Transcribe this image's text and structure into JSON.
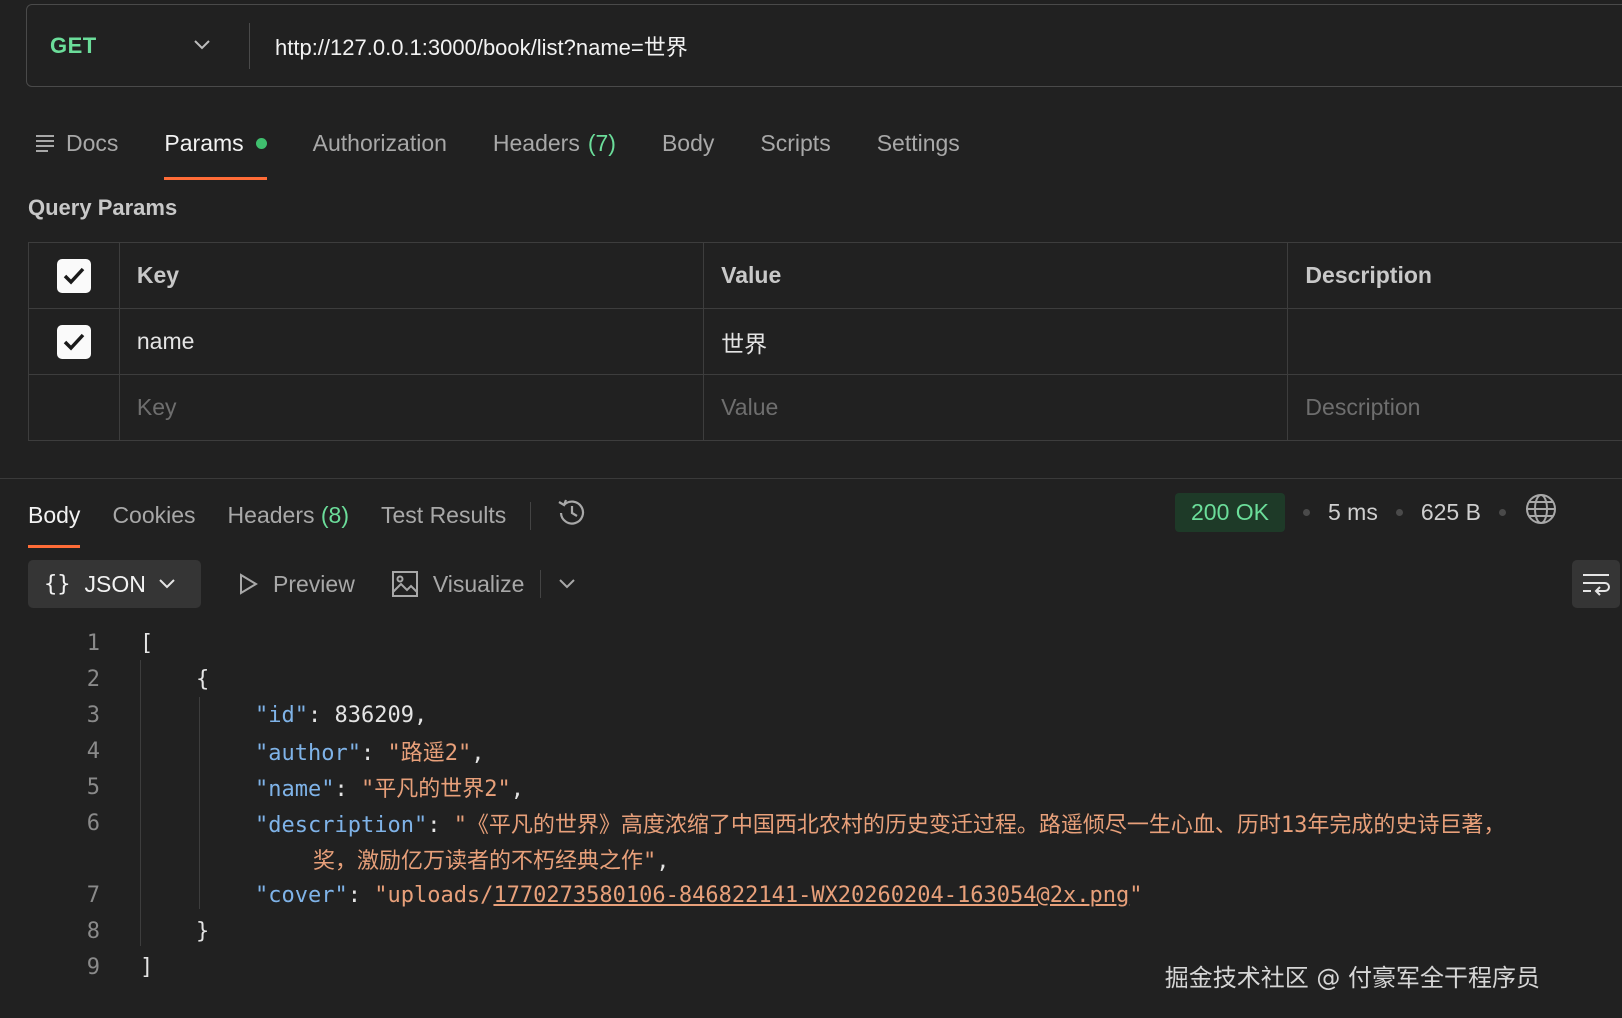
{
  "request": {
    "method": "GET",
    "url": "http://127.0.0.1:3000/book/list?name=世界"
  },
  "request_tabs": {
    "docs": "Docs",
    "params": "Params",
    "authorization": "Authorization",
    "headers": "Headers",
    "headers_count": "(7)",
    "body": "Body",
    "scripts": "Scripts",
    "settings": "Settings"
  },
  "query_params": {
    "title": "Query Params",
    "columns": {
      "key": "Key",
      "value": "Value",
      "description": "Description"
    },
    "rows": [
      {
        "checked": true,
        "key": "name",
        "value": "世界",
        "description": ""
      }
    ],
    "placeholders": {
      "key": "Key",
      "value": "Value",
      "description": "Description"
    }
  },
  "response_tabs": {
    "body": "Body",
    "cookies": "Cookies",
    "headers": "Headers",
    "headers_count": "(8)",
    "test_results": "Test Results"
  },
  "status": {
    "code": "200 OK",
    "time": "5 ms",
    "size": "625 B",
    "color": "#6bdd9a"
  },
  "format": {
    "json": "JSON",
    "preview": "Preview",
    "visualize": "Visualize"
  },
  "code": {
    "line_numbers": [
      "1",
      "2",
      "3",
      "4",
      "5",
      "6",
      "",
      "7",
      "8",
      "9"
    ],
    "open_bracket": "[",
    "open_brace": "{",
    "id_key": "\"id\"",
    "id_value": "836209",
    "author_key": "\"author\"",
    "author_value": "\"路遥2\"",
    "name_key": "\"name\"",
    "name_value": "\"平凡的世界2\"",
    "description_key": "\"description\"",
    "description_value_line1": "\"《平凡的世界》高度浓缩了中国西北农村的历史变迁过程。路遥倾尽一生心血、历时13年完成的史诗巨著，",
    "description_value_line2": "奖，激励亿万读者的不朽经典之作\"",
    "cover_key": "\"cover\"",
    "cover_prefix": "\"uploads/",
    "cover_link": "1770273580106-846822141-WX20260204-163054@2x.png",
    "cover_suffix": "\"",
    "close_brace": "}",
    "close_bracket": "]"
  },
  "watermark": "掘金技术社区 @ 付豪军全干程序员",
  "icons": [
    "chevron-down-icon",
    "docs-icon",
    "check-icon",
    "history-icon",
    "globe-icon",
    "play-icon",
    "image-icon",
    "wrap-icon"
  ]
}
